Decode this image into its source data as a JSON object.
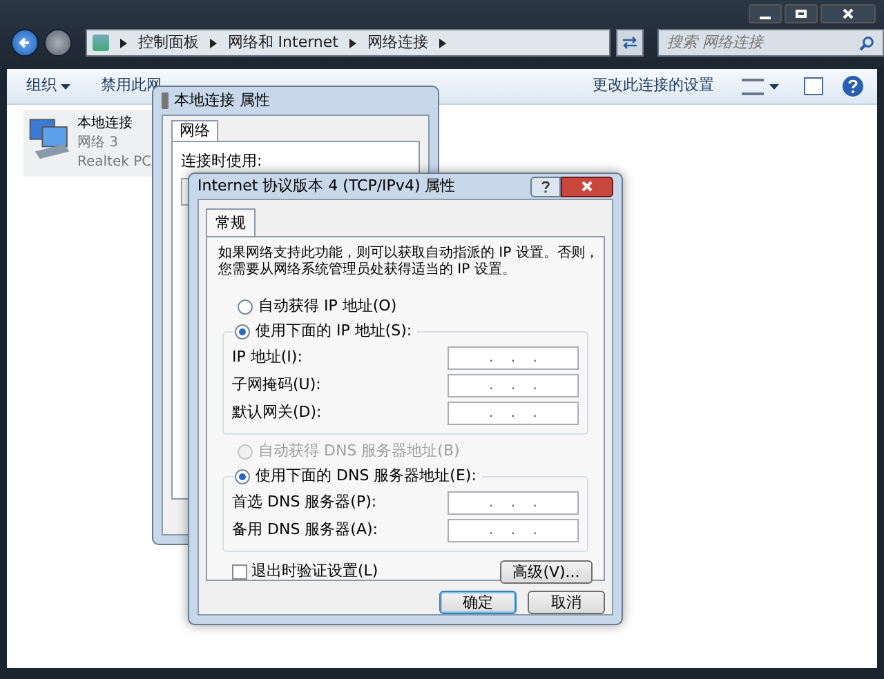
{
  "explorer": {
    "breadcrumb": [
      "控制面板",
      "网络和 Internet",
      "网络连接"
    ],
    "search": {
      "placeholder": "搜索 网络连接"
    },
    "toolbar": [
      {
        "label": "组织",
        "dropdown": true
      },
      {
        "label": "禁用此网",
        "dropdown": false
      }
    ],
    "toolbar_right": "更改此连接的设置",
    "connection": {
      "name": "本地连接",
      "network": "网络 3",
      "adapter": "Realtek PC"
    }
  },
  "props_dialog": {
    "title": "本地连接 属性",
    "tabs": [
      {
        "label": "网络",
        "selected": true
      }
    ],
    "connect_label": "连接时使用:"
  },
  "ipv4_dialog": {
    "title": "Internet 协议版本 4 (TCP/IPv4) 属性",
    "tabs": [
      {
        "label": "常规",
        "selected": true
      }
    ],
    "description": "如果网络支持此功能，则可以获取自动指派的 IP 设置。否则，您需要从网络系统管理员处获得适当的 IP 设置。",
    "ip_section": {
      "options": [
        {
          "label": "自动获得 IP 地址(O)",
          "selected": false,
          "disabled": false
        },
        {
          "label": "使用下面的 IP 地址(S):",
          "selected": true,
          "disabled": false
        }
      ],
      "fields": [
        {
          "label": "IP 地址(I):",
          "value": ".    .    ."
        },
        {
          "label": "子网掩码(U):",
          "value": ".    .    ."
        },
        {
          "label": "默认网关(D):",
          "value": ".    .    ."
        }
      ]
    },
    "dns_section": {
      "options": [
        {
          "label": "自动获得 DNS 服务器地址(B)",
          "selected": false,
          "disabled": true
        },
        {
          "label": "使用下面的 DNS 服务器地址(E):",
          "selected": true,
          "disabled": false
        }
      ],
      "fields": [
        {
          "label": "首选 DNS 服务器(P):",
          "value": ".    .    ."
        },
        {
          "label": "备用 DNS 服务器(A):",
          "value": ".    .    ."
        }
      ]
    },
    "validate": {
      "label": "退出时验证设置(L)",
      "checked": false
    },
    "advanced": "高级(V)...",
    "buttons": [
      {
        "label": "确定",
        "default": true
      },
      {
        "label": "取消",
        "default": false
      }
    ]
  }
}
